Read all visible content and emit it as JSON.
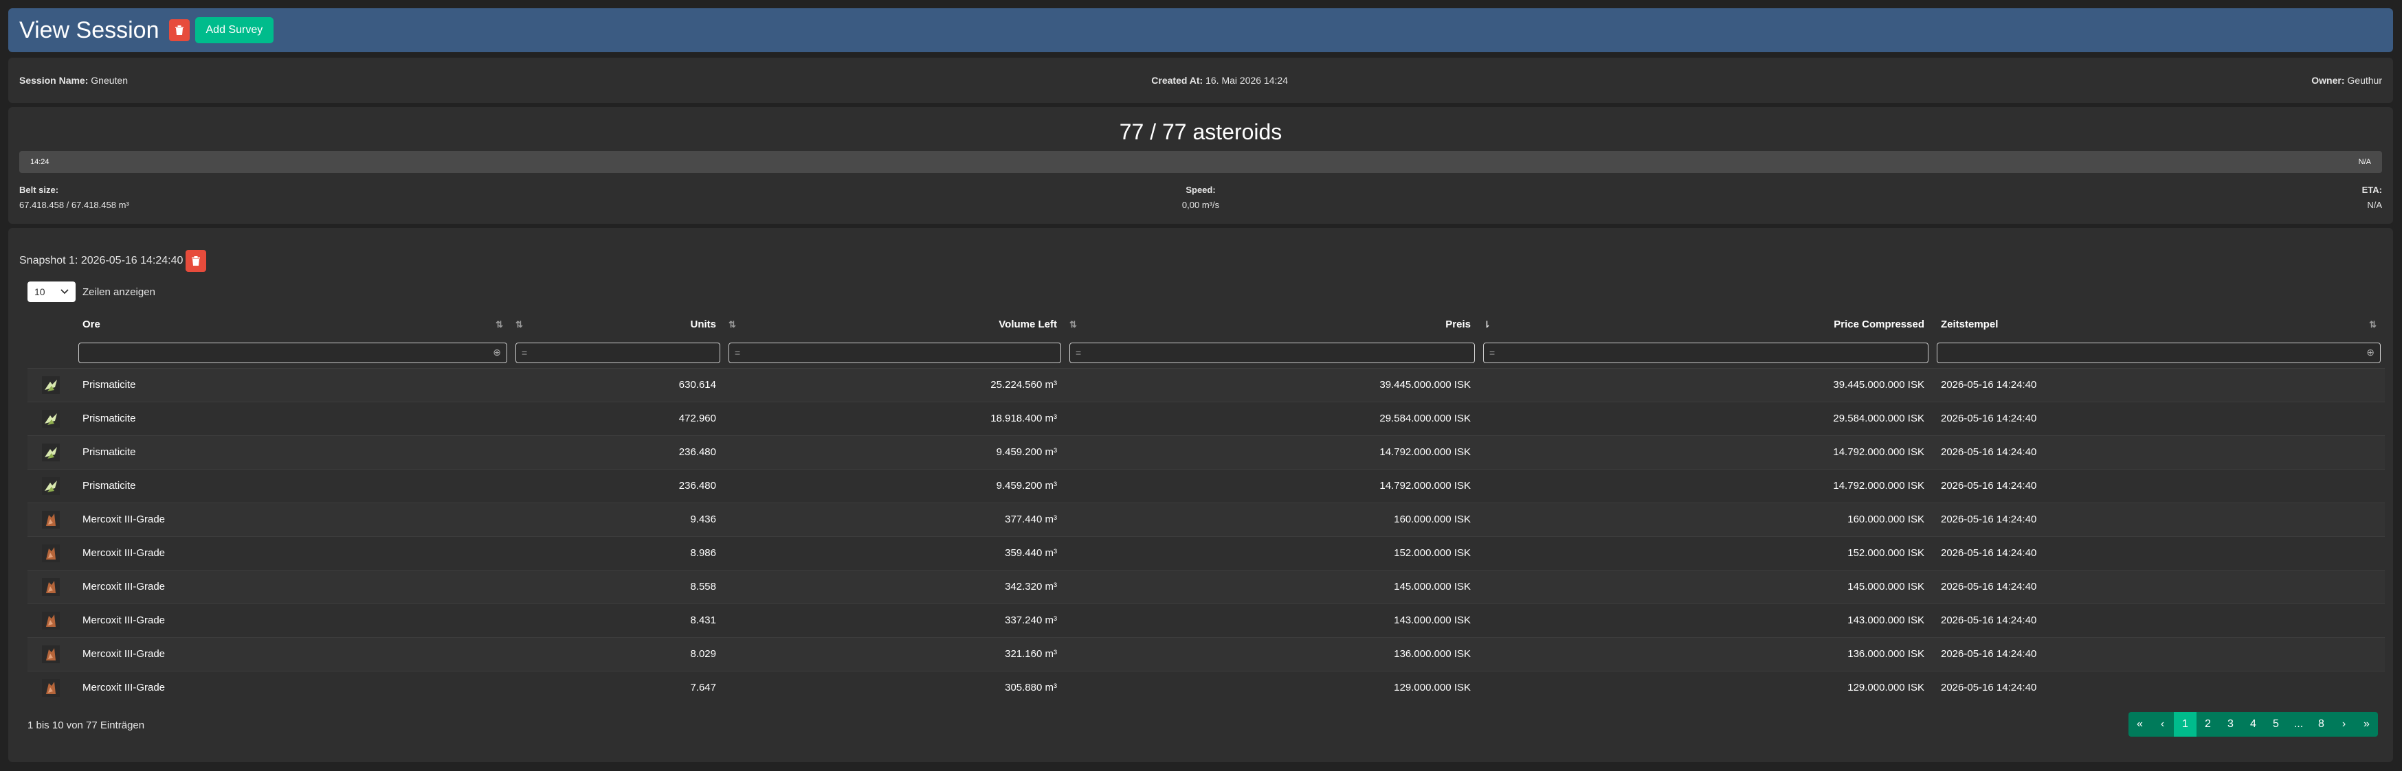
{
  "header": {
    "title": "View Session",
    "add_survey_label": "Add Survey"
  },
  "info": {
    "session_name_label": "Session Name:",
    "session_name": "Gneuten",
    "created_label": "Created At:",
    "created_at": "16. Mai 2026 14:24",
    "owner_label": "Owner:",
    "owner": "Geuthur"
  },
  "progress": {
    "count_text": "77 / 77 asteroids",
    "bar_left": "14:24",
    "bar_right": "N/A",
    "fill_fraction": 1.0,
    "belt_label": "Belt size:",
    "belt_value": "67.418.458 / 67.418.458 m³",
    "speed_label": "Speed:",
    "speed_value": "0,00 m³/s",
    "eta_label": "ETA:",
    "eta_value": "N/A"
  },
  "snapshot": {
    "title": "Snapshot 1: 2026-05-16 14:24:40",
    "page_length": "10",
    "page_length_label": "Zeilen anzeigen",
    "columns": [
      "Ore",
      "Units",
      "Volume Left",
      "Preis",
      "Price Compressed",
      "Zeitstempel"
    ],
    "rows": [
      {
        "icon": "prismaticite-icon",
        "ore": "Prismaticite",
        "units": "630.614",
        "volume": "25.224.560 m³",
        "price": "39.445.000.000 ISK",
        "compressed": "39.445.000.000 ISK",
        "time": "2026-05-16 14:24:40"
      },
      {
        "icon": "prismaticite-icon",
        "ore": "Prismaticite",
        "units": "472.960",
        "volume": "18.918.400 m³",
        "price": "29.584.000.000 ISK",
        "compressed": "29.584.000.000 ISK",
        "time": "2026-05-16 14:24:40"
      },
      {
        "icon": "prismaticite-icon",
        "ore": "Prismaticite",
        "units": "236.480",
        "volume": "9.459.200 m³",
        "price": "14.792.000.000 ISK",
        "compressed": "14.792.000.000 ISK",
        "time": "2026-05-16 14:24:40"
      },
      {
        "icon": "prismaticite-icon",
        "ore": "Prismaticite",
        "units": "236.480",
        "volume": "9.459.200 m³",
        "price": "14.792.000.000 ISK",
        "compressed": "14.792.000.000 ISK",
        "time": "2026-05-16 14:24:40"
      },
      {
        "icon": "mercoxit-icon",
        "ore": "Mercoxit III-Grade",
        "units": "9.436",
        "volume": "377.440 m³",
        "price": "160.000.000 ISK",
        "compressed": "160.000.000 ISK",
        "time": "2026-05-16 14:24:40"
      },
      {
        "icon": "mercoxit-icon",
        "ore": "Mercoxit III-Grade",
        "units": "8.986",
        "volume": "359.440 m³",
        "price": "152.000.000 ISK",
        "compressed": "152.000.000 ISK",
        "time": "2026-05-16 14:24:40"
      },
      {
        "icon": "mercoxit-icon",
        "ore": "Mercoxit III-Grade",
        "units": "8.558",
        "volume": "342.320 m³",
        "price": "145.000.000 ISK",
        "compressed": "145.000.000 ISK",
        "time": "2026-05-16 14:24:40"
      },
      {
        "icon": "mercoxit-icon",
        "ore": "Mercoxit III-Grade",
        "units": "8.431",
        "volume": "337.240 m³",
        "price": "143.000.000 ISK",
        "compressed": "143.000.000 ISK",
        "time": "2026-05-16 14:24:40"
      },
      {
        "icon": "mercoxit-icon",
        "ore": "Mercoxit III-Grade",
        "units": "8.029",
        "volume": "321.160 m³",
        "price": "136.000.000 ISK",
        "compressed": "136.000.000 ISK",
        "time": "2026-05-16 14:24:40"
      },
      {
        "icon": "mercoxit-icon",
        "ore": "Mercoxit III-Grade",
        "units": "7.647",
        "volume": "305.880 m³",
        "price": "129.000.000 ISK",
        "compressed": "129.000.000 ISK",
        "time": "2026-05-16 14:24:40"
      }
    ],
    "footer_info": "1 bis 10 von 77 Einträgen",
    "pagination": [
      "«",
      "‹",
      "1",
      "2",
      "3",
      "4",
      "5",
      "...",
      "8",
      "›",
      "»"
    ],
    "active_page": "1"
  },
  "colors": {
    "header_bg": "#3b5b82",
    "accent": "#00bc8c",
    "danger": "#e74c3c"
  }
}
